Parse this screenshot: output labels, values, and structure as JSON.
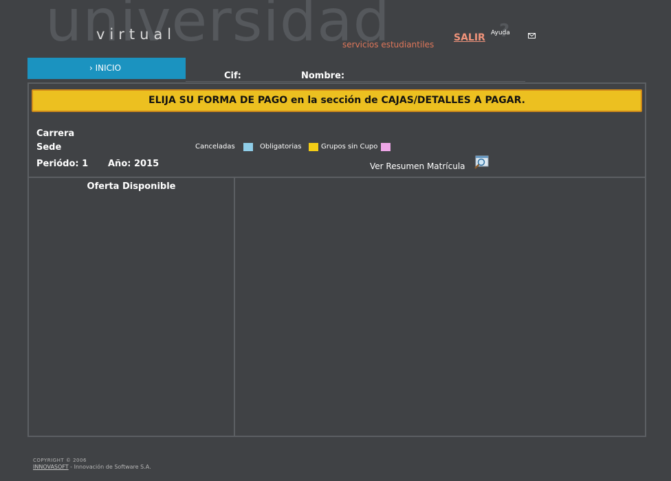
{
  "header": {
    "logo_main": "universidad",
    "logo_virtual": "virtual",
    "logo_subtitle": "servicios estudiantiles",
    "salir_label": "SALIR",
    "ayuda_label": "Ayuda",
    "ayuda_glyph": "?",
    "mail_icon": "mail-icon"
  },
  "nav": {
    "inicio_label": "› INICIO"
  },
  "student": {
    "cif_label": "Cif:",
    "nombre_label": "Nombre:"
  },
  "banner": {
    "text": "ELIJA SU FORMA DE PAGO en la sección de CAJAS/DETALLES A PAGAR."
  },
  "info": {
    "carrera_label": "Carrera",
    "sede_label": "Sede",
    "periodo": "Periódo: 1",
    "anio": "Año: 2015"
  },
  "legend": {
    "items": [
      {
        "label": "Canceladas",
        "color": "#8fcde8"
      },
      {
        "label": "Obligatorias",
        "color": "#f4cd16"
      },
      {
        "label": "Grupos sin Cupo",
        "color": "#eda6e6"
      }
    ]
  },
  "resumen": {
    "label": "Ver Resumen Matrícula",
    "icon": "magnifier-document-icon"
  },
  "panel": {
    "oferta_title": "Oferta Disponible"
  },
  "footer": {
    "copyright": "COPYRIGHT © 2006",
    "company": "INNOVASOFT",
    "company_desc": " - Innovación de Software S.A."
  }
}
